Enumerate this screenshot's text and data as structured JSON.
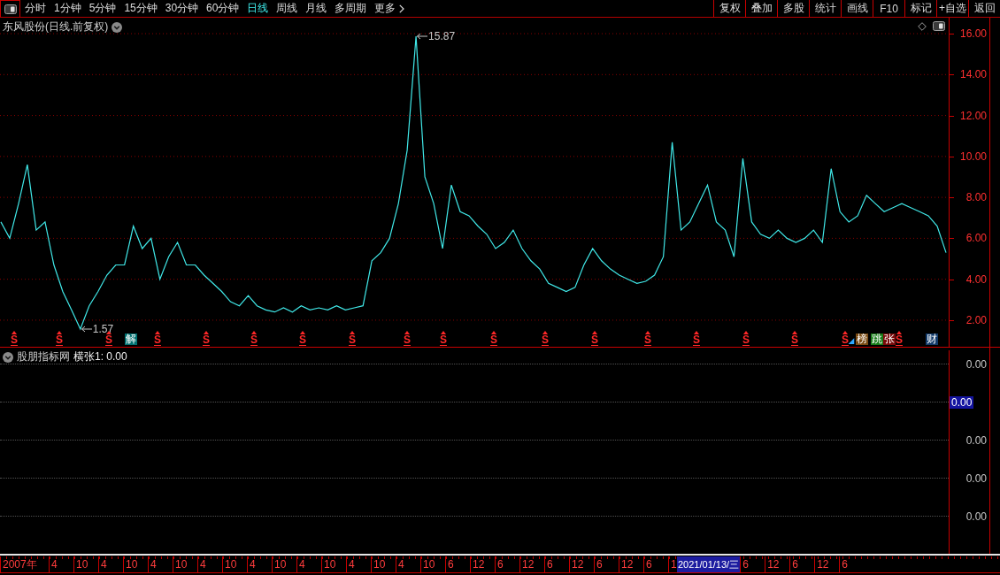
{
  "toolbar": {
    "periods": [
      {
        "label": "分时",
        "selected": false
      },
      {
        "label": "1分钟",
        "selected": false
      },
      {
        "label": "5分钟",
        "selected": false
      },
      {
        "label": "15分钟",
        "selected": false
      },
      {
        "label": "30分钟",
        "selected": false
      },
      {
        "label": "60分钟",
        "selected": false
      },
      {
        "label": "日线",
        "selected": true
      },
      {
        "label": "周线",
        "selected": false
      },
      {
        "label": "月线",
        "selected": false
      },
      {
        "label": "多周期",
        "selected": false
      }
    ],
    "more": {
      "label": "更多"
    },
    "actions": [
      "复权",
      "叠加",
      "多股",
      "统计",
      "画线",
      "F10",
      "标记",
      "+自选",
      "返回"
    ]
  },
  "price_panel": {
    "title": "东风股份(日线.前复权)",
    "chart_data": {
      "type": "line",
      "grid": true,
      "ylim": [
        0.7,
        16.78
      ],
      "yticks": [
        {
          "value": 16,
          "label": "16.00"
        },
        {
          "value": 14,
          "label": "14.00"
        },
        {
          "value": 12,
          "label": "12.00"
        },
        {
          "value": 10,
          "label": "10.00"
        },
        {
          "value": 8,
          "label": "8.00"
        },
        {
          "value": 6,
          "label": "6.00"
        },
        {
          "value": 4,
          "label": "4.00"
        },
        {
          "value": 2,
          "label": "2.00"
        }
      ],
      "series": [
        {
          "color": "#40e8e8",
          "values": [
            6.8,
            6.0,
            7.7,
            9.6,
            6.4,
            6.8,
            4.7,
            3.4,
            2.5,
            1.57,
            2.7,
            3.4,
            4.2,
            4.7,
            4.7,
            6.6,
            5.5,
            6.0,
            4.0,
            5.1,
            5.8,
            4.7,
            4.7,
            4.2,
            3.8,
            3.4,
            2.9,
            2.7,
            3.2,
            2.7,
            2.5,
            2.4,
            2.6,
            2.4,
            2.7,
            2.5,
            2.6,
            2.5,
            2.7,
            2.5,
            2.6,
            2.7,
            4.9,
            5.3,
            6.0,
            7.7,
            10.3,
            15.87,
            9.0,
            7.7,
            5.5,
            8.6,
            7.3,
            7.1,
            6.6,
            6.2,
            5.5,
            5.8,
            6.4,
            5.5,
            4.9,
            4.5,
            3.8,
            3.6,
            3.4,
            3.6,
            4.7,
            5.5,
            4.9,
            4.5,
            4.2,
            4.0,
            3.8,
            3.9,
            4.2,
            5.1,
            10.7,
            6.4,
            6.8,
            7.7,
            8.6,
            6.8,
            6.4,
            5.1,
            9.9,
            6.8,
            6.2,
            6.0,
            6.4,
            6.0,
            5.8,
            6.0,
            6.4,
            5.8,
            9.4,
            7.3,
            6.8,
            7.1,
            8.1,
            7.7,
            7.3,
            7.5,
            7.7,
            7.5,
            7.3,
            7.1,
            6.6,
            5.3
          ]
        }
      ],
      "annotations": [
        "15.87",
        "1.57"
      ]
    },
    "event_markers": [
      {
        "kind": "signal",
        "text": "S"
      },
      {
        "kind": "signal",
        "text": "S"
      },
      {
        "kind": "signal",
        "text": "S"
      },
      {
        "kind": "badge",
        "text": "解",
        "color": "#007070"
      },
      {
        "kind": "signal",
        "text": "S"
      },
      {
        "kind": "signal",
        "text": "S"
      },
      {
        "kind": "signal",
        "text": "S"
      },
      {
        "kind": "signal",
        "text": "S"
      },
      {
        "kind": "signal",
        "text": "S"
      },
      {
        "kind": "signal",
        "text": "S"
      },
      {
        "kind": "signal",
        "text": "S"
      },
      {
        "kind": "signal",
        "text": "S"
      },
      {
        "kind": "signal",
        "text": "S"
      },
      {
        "kind": "signal",
        "text": "S"
      },
      {
        "kind": "signal",
        "text": "S"
      },
      {
        "kind": "signal",
        "text": "S"
      },
      {
        "kind": "signal",
        "text": "S"
      },
      {
        "kind": "signal",
        "text": "S"
      },
      {
        "kind": "signal",
        "text": "S"
      },
      {
        "kind": "flag"
      },
      {
        "kind": "badge",
        "text": "榜",
        "color": "#7a4a12"
      },
      {
        "kind": "badge",
        "text": "跳",
        "color": "#177a17"
      },
      {
        "kind": "badge",
        "text": "张",
        "color": "#7a0a0a"
      },
      {
        "kind": "signal",
        "text": "S"
      },
      {
        "kind": "badge",
        "text": "财",
        "color": "#123a6a"
      }
    ]
  },
  "indicator_panel": {
    "source": "股朋指标网",
    "readout": "横张1: 0.00",
    "axis_labels": [
      {
        "text": "0.00",
        "kind": "tick"
      },
      {
        "text": "0.00",
        "kind": "current"
      },
      {
        "text": "0.00",
        "kind": "tick"
      },
      {
        "text": "0.00",
        "kind": "tick"
      },
      {
        "text": "0.00",
        "kind": "tick"
      }
    ]
  },
  "date_axis": [
    {
      "text": "2007年",
      "kind": "year"
    },
    {
      "text": "4",
      "kind": "tick"
    },
    {
      "text": "10",
      "kind": "tick"
    },
    {
      "text": "4",
      "kind": "tick"
    },
    {
      "text": "10",
      "kind": "tick"
    },
    {
      "text": "4",
      "kind": "tick"
    },
    {
      "text": "10",
      "kind": "tick"
    },
    {
      "text": "4",
      "kind": "tick"
    },
    {
      "text": "10",
      "kind": "tick"
    },
    {
      "text": "4",
      "kind": "tick"
    },
    {
      "text": "10",
      "kind": "tick"
    },
    {
      "text": "4",
      "kind": "tick"
    },
    {
      "text": "10",
      "kind": "tick"
    },
    {
      "text": "4",
      "kind": "tick"
    },
    {
      "text": "10",
      "kind": "tick"
    },
    {
      "text": "4",
      "kind": "tick"
    },
    {
      "text": "10",
      "kind": "tick"
    },
    {
      "text": "6",
      "kind": "tick"
    },
    {
      "text": "12",
      "kind": "tick"
    },
    {
      "text": "6",
      "kind": "tick"
    },
    {
      "text": "12",
      "kind": "tick"
    },
    {
      "text": "6",
      "kind": "tick"
    },
    {
      "text": "12",
      "kind": "tick"
    },
    {
      "text": "6",
      "kind": "tick"
    },
    {
      "text": "12",
      "kind": "tick"
    },
    {
      "text": "6",
      "kind": "tick"
    },
    {
      "text": "1",
      "kind": "tick"
    },
    {
      "text": "2021/01/13/三",
      "kind": "cursor"
    },
    {
      "text": "6",
      "kind": "tick"
    },
    {
      "text": "12",
      "kind": "tick"
    },
    {
      "text": "6",
      "kind": "tick"
    },
    {
      "text": "12",
      "kind": "tick"
    },
    {
      "text": "6",
      "kind": "tick"
    }
  ]
}
